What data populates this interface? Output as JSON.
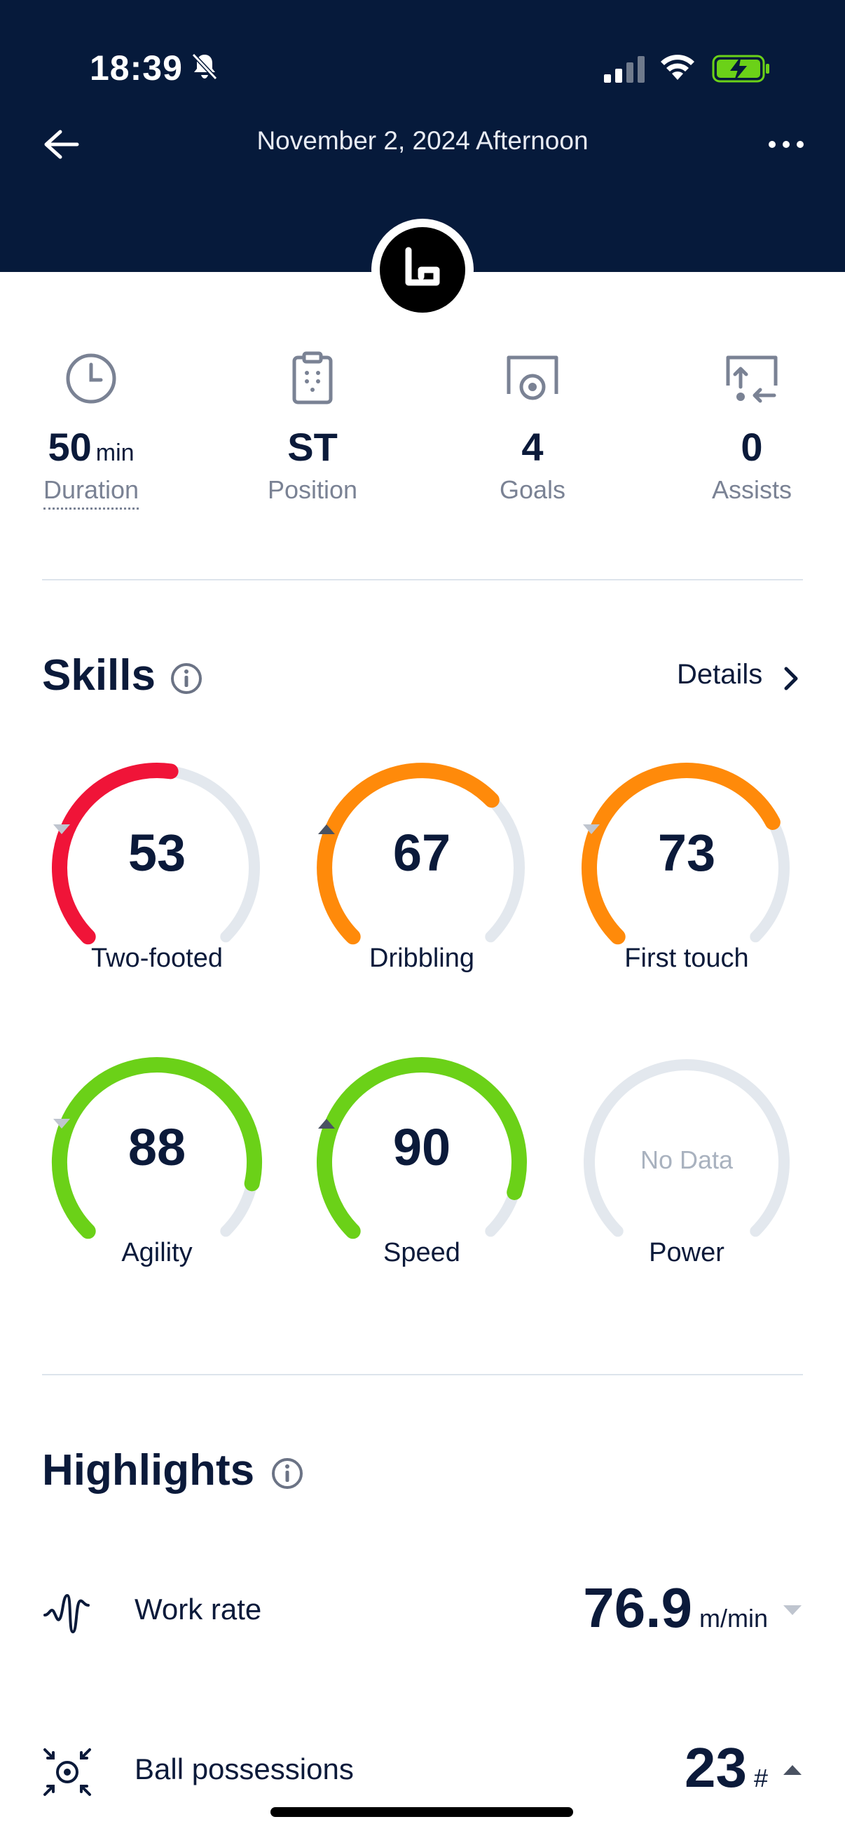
{
  "status_bar": {
    "time": "18:39"
  },
  "nav": {
    "title": "November 2, 2024 Afternoon"
  },
  "stats": [
    {
      "value": "50",
      "unit": "min",
      "label": "Duration",
      "icon": "clock-icon"
    },
    {
      "value": "ST",
      "unit": "",
      "label": "Position",
      "icon": "clipboard-icon"
    },
    {
      "value": "4",
      "unit": "",
      "label": "Goals",
      "icon": "goal-icon"
    },
    {
      "value": "0",
      "unit": "",
      "label": "Assists",
      "icon": "assist-icon"
    }
  ],
  "skills": {
    "title": "Skills",
    "details_label": "Details",
    "items": [
      {
        "label": "Two-footed",
        "value": "53",
        "trend": "down",
        "level": 0.53,
        "color": "#f01438"
      },
      {
        "label": "Dribbling",
        "value": "67",
        "trend": "up",
        "level": 0.67,
        "color": "#ff8a0a"
      },
      {
        "label": "First touch",
        "value": "73",
        "trend": "down",
        "level": 0.73,
        "color": "#ff8a0a"
      },
      {
        "label": "Agility",
        "value": "88",
        "trend": "down",
        "level": 0.88,
        "color": "#6bd118"
      },
      {
        "label": "Speed",
        "value": "90",
        "trend": "up",
        "level": 0.9,
        "color": "#6bd118"
      },
      {
        "label": "Power",
        "value": "",
        "nodata": "No Data",
        "trend": "none",
        "level": 0,
        "color": "#dfe5ec"
      }
    ]
  },
  "highlights": {
    "title": "Highlights",
    "items": [
      {
        "name": "Work rate",
        "value": "76.9",
        "unit": "m/min",
        "trend": "down",
        "icon": "work-rate-icon"
      },
      {
        "name": "Ball possessions",
        "value": "23",
        "unit": "#",
        "trend": "up",
        "icon": "ball-possession-icon"
      }
    ]
  },
  "colors": {
    "header_bg": "#061a3b",
    "text_dark": "#0b1a3a",
    "track": "#e3e8ee"
  }
}
